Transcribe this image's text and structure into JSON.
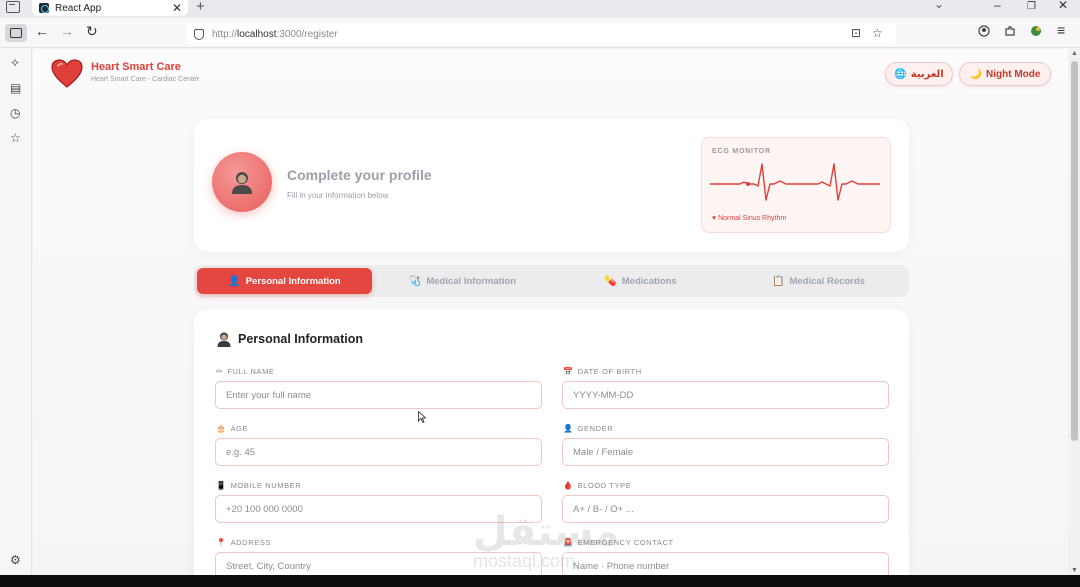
{
  "browser": {
    "tab_title": "React App",
    "tab_close": "✕",
    "new_tab": "+",
    "url_prefix": "http://",
    "url_host": "localhost",
    "url_path": ":3000/register"
  },
  "header": {
    "brand_title": "Heart Smart Care",
    "brand_subtitle": "Heart Smart Care - Cardiac Center",
    "language_button": "العربية",
    "night_mode_button": "Night Mode"
  },
  "profile": {
    "title": "Complete your profile",
    "subtitle": "Fill in your information below",
    "ecg_label": "ECG MONITOR",
    "ecg_status": "♥ Normal Sinus Rhythm"
  },
  "tabs": [
    {
      "label": "Personal Information",
      "icon": "person-icon",
      "glyph": "👤"
    },
    {
      "label": "Medical Information",
      "icon": "stethoscope-icon",
      "glyph": "🩺"
    },
    {
      "label": "Medications",
      "icon": "pill-icon",
      "glyph": "💊"
    },
    {
      "label": "Medical Records",
      "icon": "clipboard-icon",
      "glyph": "📋"
    }
  ],
  "form": {
    "section_title": "Personal Information",
    "fields": [
      {
        "label": "FULL NAME",
        "glyph": "✏",
        "placeholder": "Enter your full name"
      },
      {
        "label": "DATE OF BIRTH",
        "glyph": "📅",
        "placeholder": "YYYY-MM-DD"
      },
      {
        "label": "AGE",
        "glyph": "🎂",
        "placeholder": "e.g. 45"
      },
      {
        "label": "GENDER",
        "glyph": "👤",
        "placeholder": "Male / Female"
      },
      {
        "label": "MOBILE NUMBER",
        "glyph": "📱",
        "placeholder": "+20 100 000 0000"
      },
      {
        "label": "BLOOD TYPE",
        "glyph": "🩸",
        "placeholder": "A+ / B- / O+ ..."
      },
      {
        "label": "ADDRESS",
        "glyph": "📍",
        "placeholder": "Street, City, Country"
      },
      {
        "label": "EMERGENCY CONTACT",
        "glyph": "🚨",
        "placeholder": "Name · Phone number"
      }
    ]
  },
  "watermark": {
    "main": "مستقل",
    "sub": "mostaql.com"
  },
  "colors": {
    "accent": "#e44740",
    "brand": "#e0403a",
    "input_border": "#f1c6c6"
  }
}
